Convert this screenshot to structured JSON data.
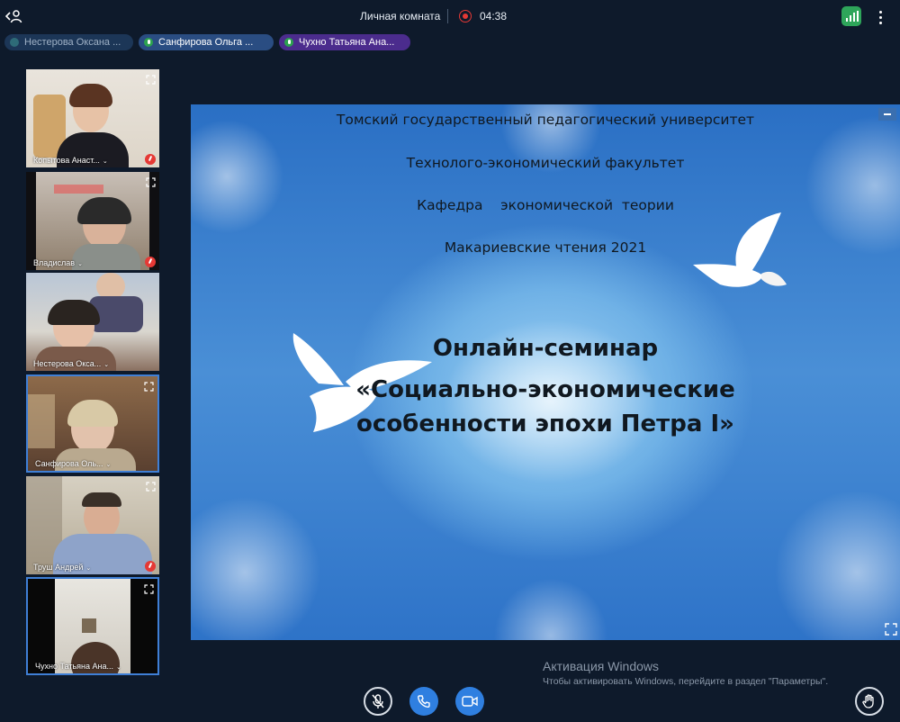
{
  "topbar": {
    "room_title": "Личная комната",
    "timer": "04:38",
    "record_color": "#e53935",
    "signal_color": "#2ea55a"
  },
  "chips": [
    {
      "label": "Нестерова Оксана ...",
      "state": "inactive"
    },
    {
      "label": "Санфирова Ольга ...",
      "state": "mic"
    },
    {
      "label": "Чухно Татьяна Ана...",
      "state": "mic"
    }
  ],
  "tiles": [
    {
      "name": "Копытова Анаст...",
      "muted": true
    },
    {
      "name": "Владислав",
      "muted": true
    },
    {
      "name": "Нестерова Окса...",
      "muted": false
    },
    {
      "name": "Санфирова Оль...",
      "muted": false
    },
    {
      "name": "Труш Андрей",
      "muted": true
    },
    {
      "name": "Чухно Татьяна Ана...",
      "muted": false
    }
  ],
  "slide": {
    "line1": "Томский государственный педагогический университет",
    "line2": "Технолого-экономический факультет",
    "line3": "Кафедра    экономической  теории",
    "line4": "Макариевские чтения 2021",
    "title1": "Онлайн-семинар",
    "title2": "«Социально-экономические",
    "title3": "особенности эпохи Петра I»"
  },
  "watermark": {
    "title": "Активация Windows",
    "subtitle": "Чтобы активировать Windows, перейдите в раздел \"Параметры\"."
  },
  "controls": {
    "accent": "#2f7fe0"
  }
}
